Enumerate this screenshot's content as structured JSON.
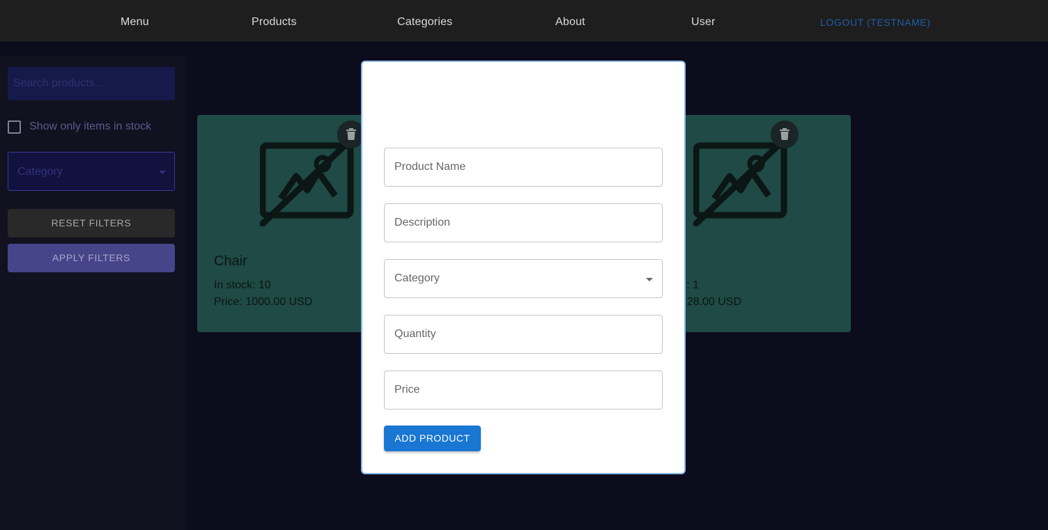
{
  "nav": {
    "menu": "Menu",
    "products": "Products",
    "categories": "Categories",
    "about": "About",
    "user": "User",
    "logout": "LOGOUT (TESTNAME)"
  },
  "sidebar": {
    "search_placeholder": "Search products...",
    "stock_filter_label": "Show only items in stock",
    "category_placeholder": "Category",
    "reset_label": "RESET FILTERS",
    "apply_label": "APPLY FILTERS"
  },
  "products": [
    {
      "name": "Chair",
      "stock": "In stock: 10",
      "price": "Price: 1000.00 USD"
    },
    {
      "name": "",
      "stock": ": 1",
      "price": "28.00 USD"
    }
  ],
  "modal": {
    "fields": {
      "name": "Product Name",
      "description": "Description",
      "category": "Category",
      "quantity": "Quantity",
      "price": "Price"
    },
    "submit_label": "ADD PRODUCT"
  },
  "colors": {
    "accent": "#1976d2",
    "card": "#1f4a45",
    "logout": "#1e5ea8"
  }
}
